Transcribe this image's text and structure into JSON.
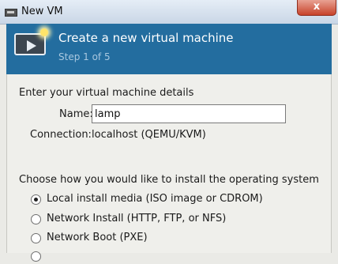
{
  "window": {
    "title": "New VM",
    "close_label": "x"
  },
  "banner": {
    "title": "Create a new virtual machine",
    "step": "Step 1 of 5",
    "icon": "vm-monitor-play-icon"
  },
  "details": {
    "heading": "Enter your virtual machine details",
    "name_label": "Name:",
    "name_value": "lamp",
    "connection_label": "Connection:",
    "connection_value": "localhost (QEMU/KVM)"
  },
  "install": {
    "heading": "Choose how you would like to install the operating system",
    "options": [
      {
        "label": "Local install media (ISO image or CDROM)",
        "checked": true
      },
      {
        "label": "Network Install (HTTP, FTP, or NFS)",
        "checked": false
      },
      {
        "label": "Network Boot (PXE)",
        "checked": false
      }
    ]
  },
  "colors": {
    "banner_bg": "#236d9f",
    "window_bg": "#efefeb",
    "close_button": "#c7432a"
  }
}
